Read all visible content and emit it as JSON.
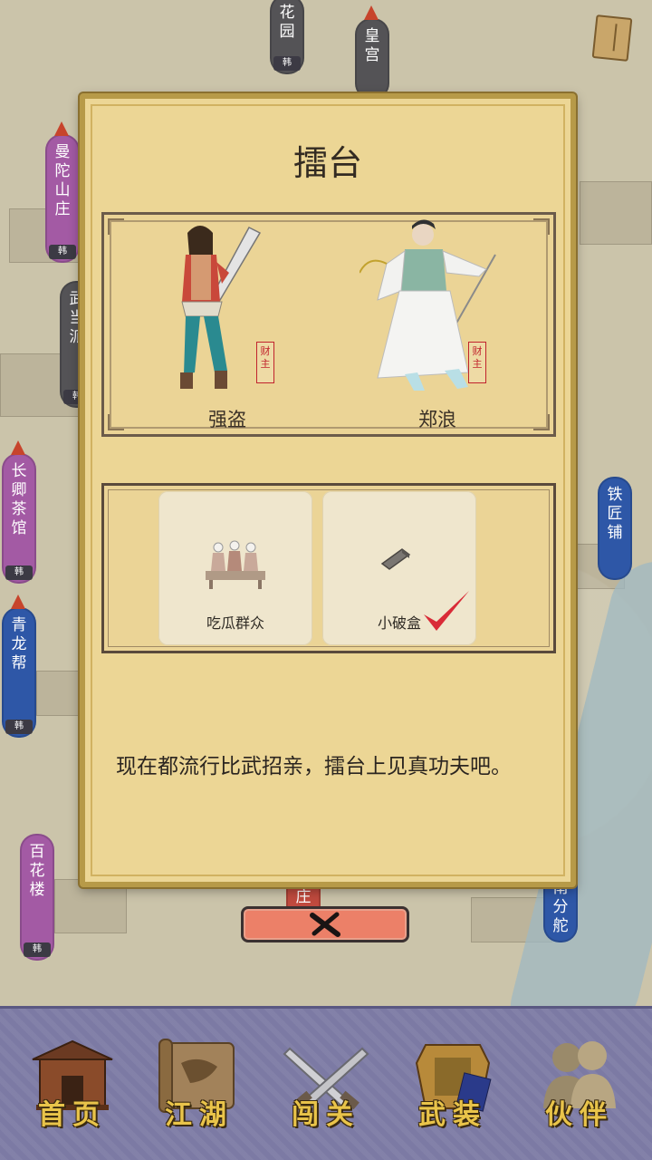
{
  "map": {
    "locations": [
      {
        "name": "花园",
        "tag": "韩"
      },
      {
        "name": "皇宫",
        "tag": ""
      },
      {
        "name": "曼陀山庄",
        "tag": "韩"
      },
      {
        "name": "武当派",
        "tag": "韩"
      },
      {
        "name": "长卿茶馆",
        "tag": "韩"
      },
      {
        "name": "青龙帮",
        "tag": "韩"
      },
      {
        "name": "百花楼",
        "tag": "韩"
      },
      {
        "name": "铁匠铺",
        "tag": ""
      },
      {
        "name": "南分舵",
        "tag": ""
      },
      {
        "name": "庄",
        "tag": ""
      }
    ]
  },
  "dialog": {
    "title": "擂台",
    "fighters": [
      {
        "name": "强盗",
        "seal": "财主"
      },
      {
        "name": "郑浪",
        "seal": "财主"
      }
    ],
    "items": [
      {
        "label": "吃瓜群众",
        "selected": false
      },
      {
        "label": "小破盒",
        "selected": true
      }
    ],
    "description": "现在都流行比武招亲，擂台上见真功夫吧。",
    "close_icon": "close-icon"
  },
  "nav": {
    "items": [
      {
        "label": "首页",
        "icon": "house-icon"
      },
      {
        "label": "江湖",
        "icon": "scroll-map-icon"
      },
      {
        "label": "闯关",
        "icon": "crossed-swords-icon"
      },
      {
        "label": "武装",
        "icon": "armor-icon"
      },
      {
        "label": "伙伴",
        "icon": "companions-icon"
      }
    ]
  },
  "colors": {
    "dialog_bg": "#ecd695",
    "close_button": "#ec8068",
    "nav_bg": "#7c7aa4",
    "nav_label": "#e9c44a",
    "check": "#d92b37"
  }
}
